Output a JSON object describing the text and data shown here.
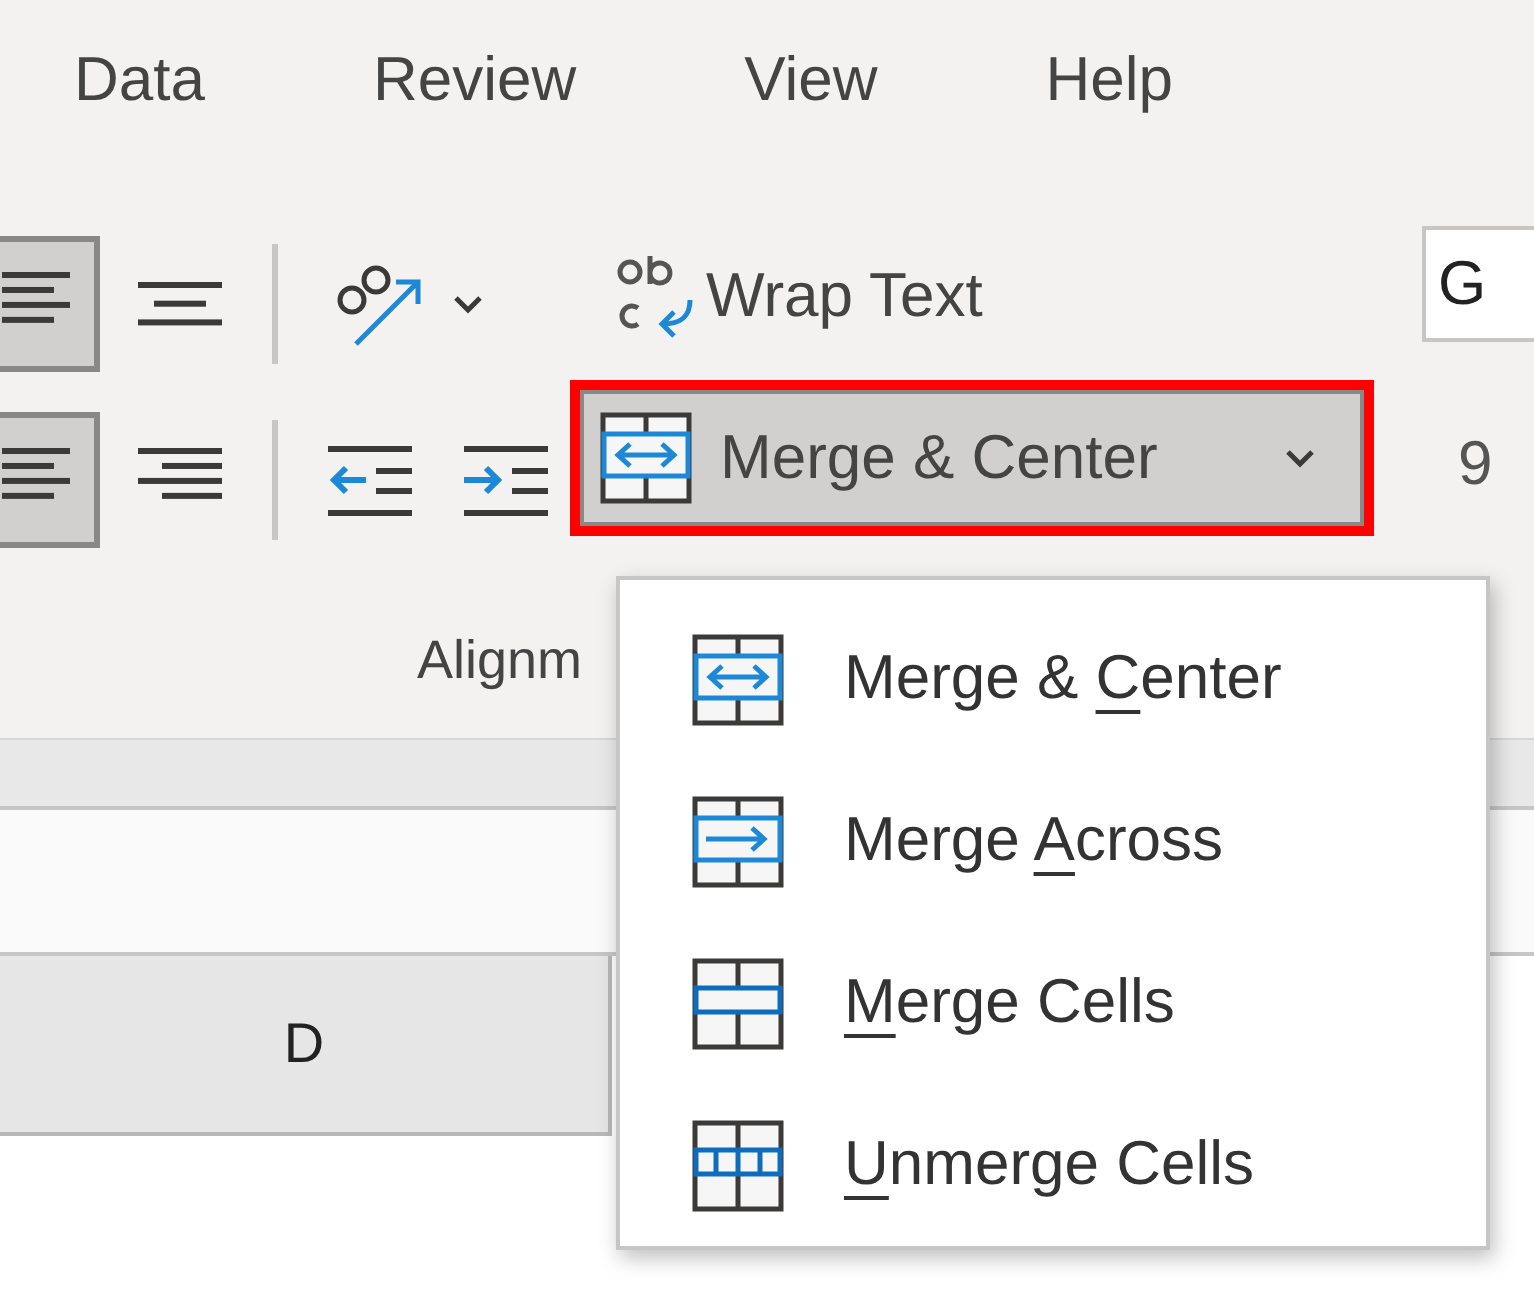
{
  "tabs": [
    {
      "label": "Data"
    },
    {
      "label": "Review"
    },
    {
      "label": "View"
    },
    {
      "label": "Help"
    }
  ],
  "ribbon": {
    "alignment_buttons": [
      {
        "kind": "lines-left",
        "selected": true
      },
      {
        "kind": "lines-center",
        "selected": false
      },
      {
        "kind": "orientation",
        "selected": false
      },
      {
        "kind": "lines-left",
        "selected": true
      },
      {
        "kind": "lines-right",
        "selected": false
      },
      {
        "kind": "indent-decrease",
        "selected": false
      },
      {
        "kind": "indent-increase",
        "selected": false
      }
    ],
    "wrap_text": {
      "label": "Wrap Text"
    },
    "merge_button": {
      "label": "Merge & Center",
      "highlighted": true
    },
    "group_label": "Alignm",
    "number_format_field": {
      "value": "G"
    },
    "partial_text": "9"
  },
  "column_header": "D",
  "menu": {
    "items": [
      {
        "kind": "merge-center",
        "label_parts": [
          {
            "text": "Merge & ",
            "underlined": false
          },
          {
            "text": "C",
            "underlined": true
          },
          {
            "text": "enter",
            "underlined": false
          }
        ]
      },
      {
        "kind": "merge-across",
        "label_parts": [
          {
            "text": "Merge ",
            "underlined": false
          },
          {
            "text": "A",
            "underlined": true
          },
          {
            "text": "cross",
            "underlined": false
          }
        ]
      },
      {
        "kind": "merge-cells",
        "label_parts": [
          {
            "text": "M",
            "underlined": true
          },
          {
            "text": "erge Cells",
            "underlined": false
          }
        ]
      },
      {
        "kind": "unmerge",
        "label_parts": [
          {
            "text": "U",
            "underlined": true
          },
          {
            "text": "nmerge Cells",
            "underlined": false
          }
        ]
      }
    ]
  }
}
